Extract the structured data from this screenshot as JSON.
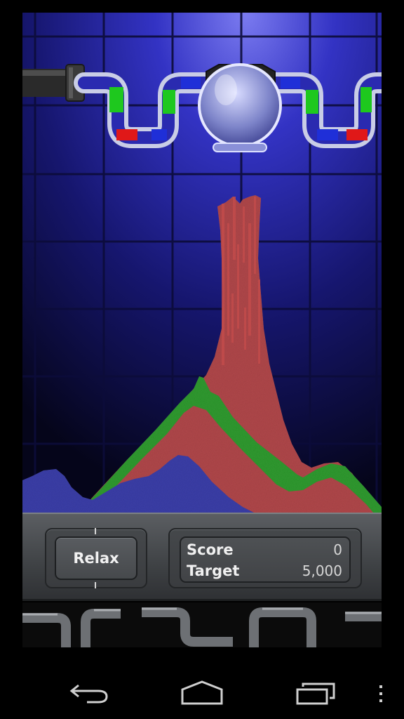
{
  "hud": {
    "relax_label": "Relax",
    "score_label": "Score",
    "score_value": "0",
    "target_label": "Target",
    "target_value": "5,000"
  },
  "colors": {
    "background_top": "#3d3dc8",
    "background_bottom": "#07071f",
    "sand_red": "#b0474a",
    "sand_green": "#2f9a2f",
    "sand_blue": "#3b3ea8",
    "pipe_blue": "#1f2fd8",
    "pipe_green": "#1ec81e",
    "pipe_red": "#e01818"
  },
  "icons": {
    "back": "back-arrow-icon",
    "home": "home-icon",
    "recents": "recent-apps-icon",
    "menu": "overflow-menu-icon"
  }
}
